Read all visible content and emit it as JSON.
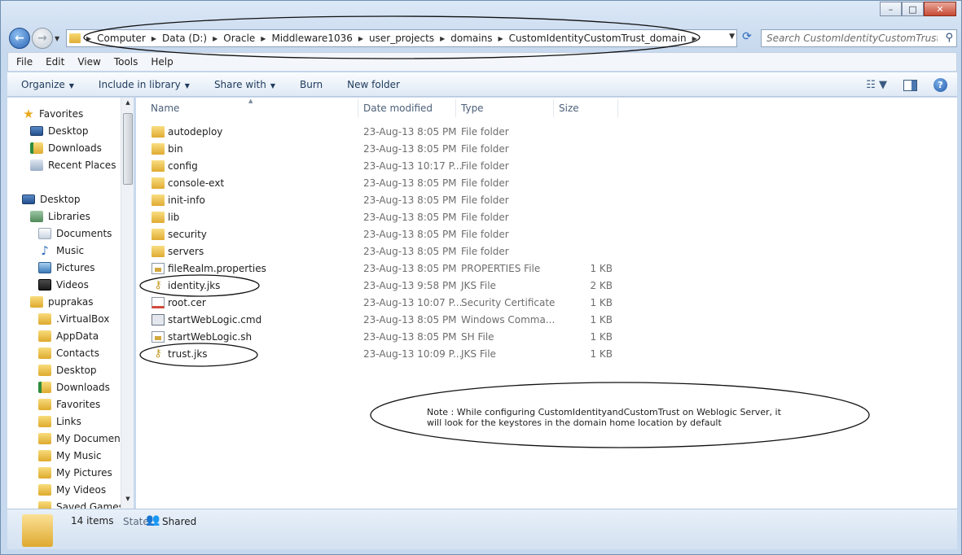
{
  "window": {
    "min_glyph": "–",
    "max_glyph": "□",
    "close_glyph": "✕"
  },
  "address": {
    "crumbs": [
      "Computer",
      "Data (D:)",
      "Oracle",
      "Middleware1036",
      "user_projects",
      "domains",
      "CustomIdentityCustomTrust_domain"
    ]
  },
  "search": {
    "placeholder": "Search CustomIdentityCustomTrust_d..."
  },
  "menu": [
    "File",
    "Edit",
    "View",
    "Tools",
    "Help"
  ],
  "commands": {
    "organize": "Organize",
    "include": "Include in library",
    "share": "Share with",
    "burn": "Burn",
    "newfolder": "New folder"
  },
  "nav": {
    "favorites": "Favorites",
    "desktop": "Desktop",
    "downloads": "Downloads",
    "recent": "Recent Places",
    "desktop2": "Desktop",
    "libraries": "Libraries",
    "documents": "Documents",
    "music": "Music",
    "pictures": "Pictures",
    "videos": "Videos",
    "user": "puprakas",
    "virtualbox": ".VirtualBox",
    "appdata": "AppData",
    "contacts": "Contacts",
    "u_desktop": "Desktop",
    "u_downloads": "Downloads",
    "u_favorites": "Favorites",
    "links": "Links",
    "mydocs": "My Documents",
    "mymusic": "My Music",
    "mypics": "My Pictures",
    "myvideos": "My Videos",
    "savedgames": "Saved Games"
  },
  "columns": {
    "name": "Name",
    "date": "Date modified",
    "type": "Type",
    "size": "Size"
  },
  "files": [
    {
      "name": "autodeploy",
      "date": "23-Aug-13 8:05 PM",
      "type": "File folder",
      "size": "",
      "icon": "folder"
    },
    {
      "name": "bin",
      "date": "23-Aug-13 8:05 PM",
      "type": "File folder",
      "size": "",
      "icon": "folder"
    },
    {
      "name": "config",
      "date": "23-Aug-13 10:17 P...",
      "type": "File folder",
      "size": "",
      "icon": "folder"
    },
    {
      "name": "console-ext",
      "date": "23-Aug-13 8:05 PM",
      "type": "File folder",
      "size": "",
      "icon": "folder"
    },
    {
      "name": "init-info",
      "date": "23-Aug-13 8:05 PM",
      "type": "File folder",
      "size": "",
      "icon": "folder"
    },
    {
      "name": "lib",
      "date": "23-Aug-13 8:05 PM",
      "type": "File folder",
      "size": "",
      "icon": "folder"
    },
    {
      "name": "security",
      "date": "23-Aug-13 8:05 PM",
      "type": "File folder",
      "size": "",
      "icon": "folder"
    },
    {
      "name": "servers",
      "date": "23-Aug-13 8:05 PM",
      "type": "File folder",
      "size": "",
      "icon": "folder"
    },
    {
      "name": "fileRealm.properties",
      "date": "23-Aug-13 8:05 PM",
      "type": "PROPERTIES File",
      "size": "1 KB",
      "icon": "doc"
    },
    {
      "name": "identity.jks",
      "date": "23-Aug-13 9:58 PM",
      "type": "JKS File",
      "size": "2 KB",
      "icon": "key"
    },
    {
      "name": "root.cer",
      "date": "23-Aug-13 10:07 P...",
      "type": "Security Certificate",
      "size": "1 KB",
      "icon": "cert"
    },
    {
      "name": "startWebLogic.cmd",
      "date": "23-Aug-13 8:05 PM",
      "type": "Windows Comma...",
      "size": "1 KB",
      "icon": "cmd"
    },
    {
      "name": "startWebLogic.sh",
      "date": "23-Aug-13 8:05 PM",
      "type": "SH File",
      "size": "1 KB",
      "icon": "doc"
    },
    {
      "name": "trust.jks",
      "date": "23-Aug-13 10:09 P...",
      "type": "JKS File",
      "size": "1 KB",
      "icon": "key"
    }
  ],
  "note": {
    "line1": "Note : While configuring CustomIdentityandCustomTrust on Weblogic Server, it",
    "line2": "will look for the keystores in the domain home location by default"
  },
  "status": {
    "count": "14 items",
    "state_label": "State:",
    "state": "Shared"
  }
}
